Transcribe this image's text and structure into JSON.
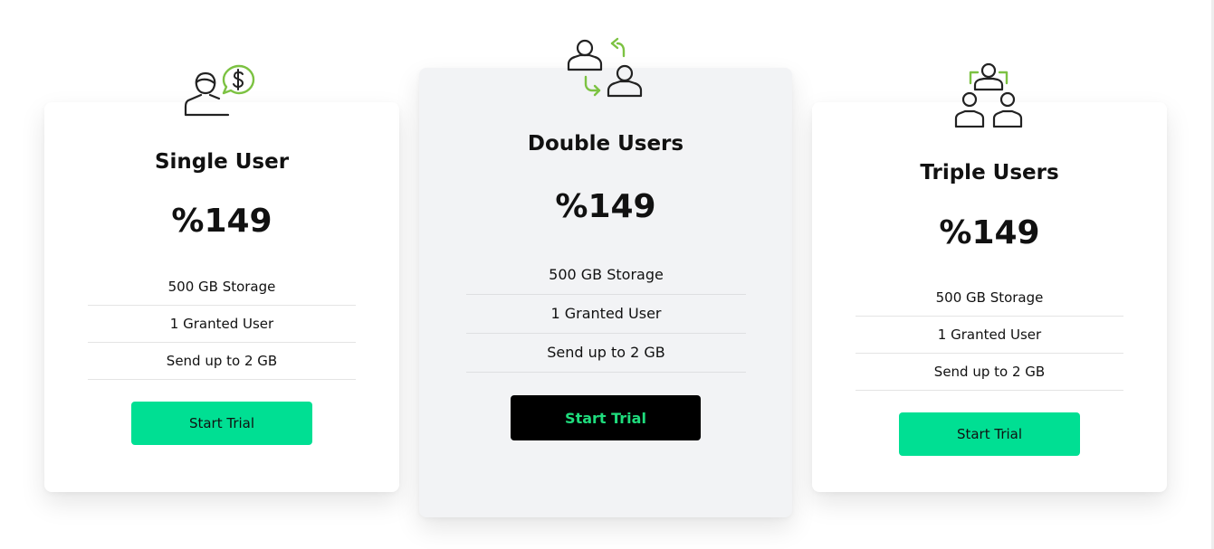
{
  "accent_color": "#7cc242",
  "button_color": "#00df93",
  "plans": [
    {
      "icon": "user-dollar-icon",
      "title": "Single User",
      "price": "%149",
      "features": [
        "500 GB Storage",
        "1 Granted User",
        "Send up to 2 GB"
      ],
      "button_label": "Start Trial"
    },
    {
      "icon": "users-exchange-icon",
      "title": "Double Users",
      "price": "%149",
      "features": [
        "500 GB Storage",
        "1 Granted User",
        "Send up to 2 GB"
      ],
      "button_label": "Start Trial"
    },
    {
      "icon": "users-team-icon",
      "title": "Triple Users",
      "price": "%149",
      "features": [
        "500 GB Storage",
        "1 Granted User",
        "Send up to 2 GB"
      ],
      "button_label": "Start Trial"
    }
  ]
}
